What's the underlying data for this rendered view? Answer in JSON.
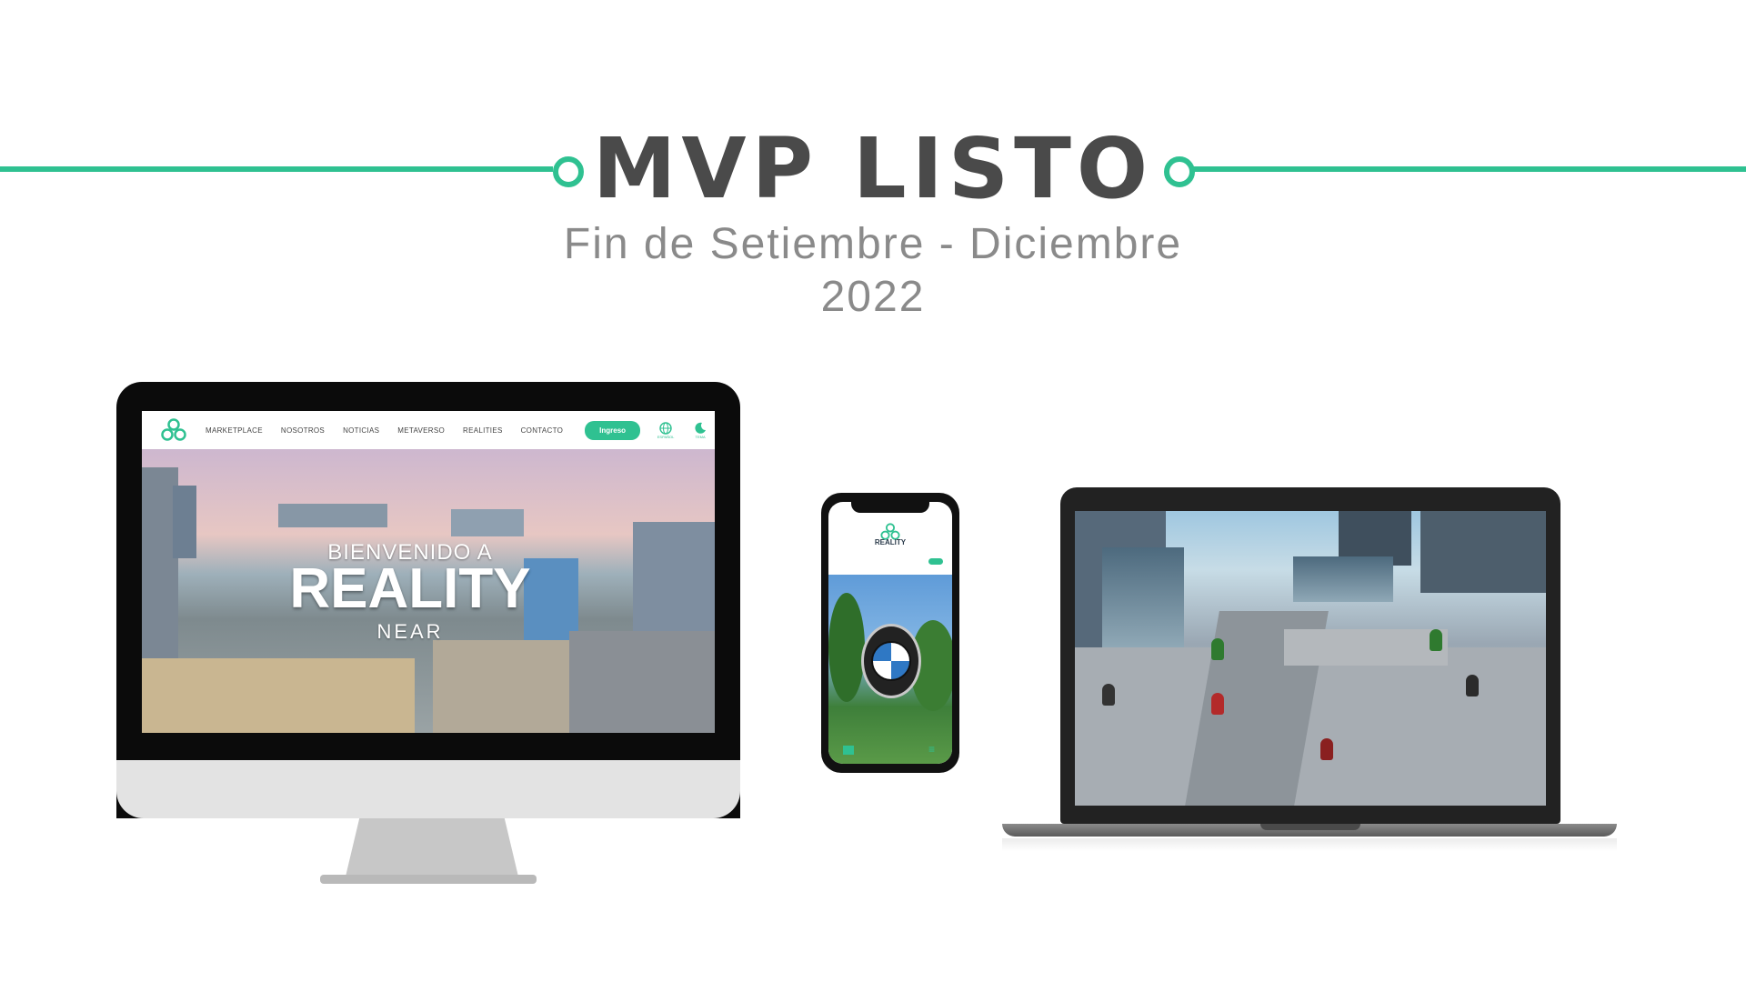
{
  "header": {
    "title": "MVP LISTO",
    "subtitle_line1": "Fin de Setiembre - Diciembre",
    "subtitle_line2": "2022"
  },
  "colors": {
    "accent": "#2fc191",
    "title": "#4a4a4a",
    "subtitle": "#8a8a8a"
  },
  "website": {
    "nav": {
      "logo_icon": "reality-logo-icon",
      "items": [
        "MARKETPLACE",
        "NOSOTROS",
        "NOTICIAS",
        "METAVERSO",
        "REALITIES",
        "CONTACTO"
      ],
      "login_button": "Ingreso",
      "language_icon": "globe-icon",
      "language_label": "ESPAÑOL",
      "theme_icon": "moon-icon",
      "theme_label": "TEMA"
    },
    "hero": {
      "line1": "BIENVENIDO A",
      "line2": "REALITY",
      "line3": "NEAR"
    }
  },
  "phone": {
    "brand": "REALITY",
    "emblem_icon": "bmw-emblem",
    "map_icon": "map-icon",
    "menu_icon": "menu-icon"
  },
  "laptop": {
    "scene": "3d-metaverse-plaza"
  }
}
